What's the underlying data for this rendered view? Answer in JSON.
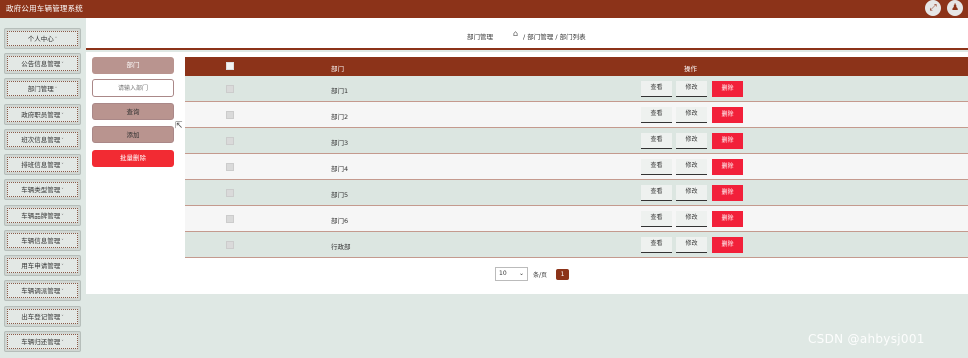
{
  "header": {
    "app_title": "政府公用车辆管理系统",
    "fullscreen_icon": "expand-arrows-icon",
    "user_icon": "user-icon"
  },
  "sidebar": {
    "items": [
      {
        "label": "个人中心"
      },
      {
        "label": "公告信息管理"
      },
      {
        "label": "部门管理"
      },
      {
        "label": "政府职员管理"
      },
      {
        "label": "班次信息管理"
      },
      {
        "label": "排班信息管理"
      },
      {
        "label": "车辆类型管理"
      },
      {
        "label": "车辆品牌管理"
      },
      {
        "label": "车辆信息管理"
      },
      {
        "label": "用车申请管理"
      },
      {
        "label": "车辆调派管理"
      },
      {
        "label": "出车登记管理"
      },
      {
        "label": "车辆归还管理"
      }
    ],
    "caret": "˅"
  },
  "breadcrumb": {
    "module": "部门管理",
    "home_icon": "home-icon",
    "home_glyph": "⌂",
    "path": "/ 部门管理 / 部门列表"
  },
  "search": {
    "label": "部门",
    "placeholder": "请输入部门",
    "query_button": "查询",
    "add_button": "添加",
    "batch_delete_button": "批量删除"
  },
  "table": {
    "header_name": "部门",
    "header_ops": "操作",
    "rows": [
      {
        "name": "部门1"
      },
      {
        "name": "部门2"
      },
      {
        "name": "部门3"
      },
      {
        "name": "部门4"
      },
      {
        "name": "部门5"
      },
      {
        "name": "部门6"
      },
      {
        "name": "行政部"
      }
    ],
    "view_label": "查看",
    "edit_label": "修改",
    "delete_label": "删除"
  },
  "pagination": {
    "page_size": "10",
    "page_size_label": "条/页",
    "current_page": "1"
  },
  "watermark": "CSDN @ahbysj001",
  "colors": {
    "brand": "#8c3319",
    "danger": "#f2203a",
    "sidebar_bg": "#dfe8e4"
  }
}
